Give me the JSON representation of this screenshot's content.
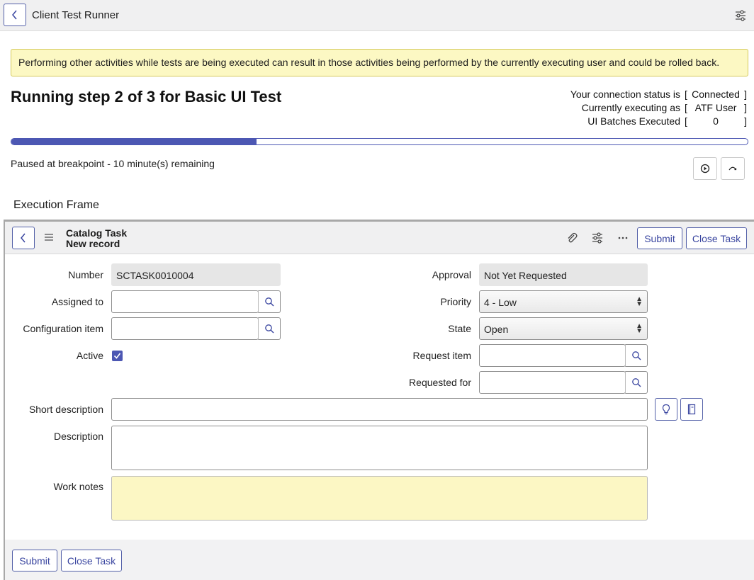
{
  "topbar": {
    "title": "Client Test Runner"
  },
  "warning": {
    "text": "Performing other activities while tests are being executed can result in those activities being performed by the currently executing user and could be rolled back."
  },
  "run": {
    "title": "Running step 2 of 3 for Basic UI Test",
    "progress_fraction": 0.333,
    "paused_text": "Paused at breakpoint - 10 minute(s) remaining"
  },
  "status": [
    {
      "label": "Your connection status is",
      "value": "Connected"
    },
    {
      "label": "Currently executing as",
      "value": "ATF User"
    },
    {
      "label": "UI Batches Executed",
      "value": "0"
    }
  ],
  "execution_frame": {
    "label": "Execution Frame"
  },
  "form": {
    "header": {
      "title": "Catalog Task",
      "subtitle": "New record",
      "submit_label": "Submit",
      "close_label": "Close Task"
    },
    "fields": {
      "number_label": "Number",
      "number_value": "SCTASK0010004",
      "assigned_to_label": "Assigned to",
      "assigned_to_value": "",
      "config_item_label": "Configuration item",
      "config_item_value": "",
      "active_label": "Active",
      "approval_label": "Approval",
      "approval_value": "Not Yet Requested",
      "priority_label": "Priority",
      "priority_value": "4 - Low",
      "state_label": "State",
      "state_value": "Open",
      "request_item_label": "Request item",
      "request_item_value": "",
      "requested_for_label": "Requested for",
      "requested_for_value": "",
      "short_description_label": "Short description",
      "description_label": "Description",
      "work_notes_label": "Work notes"
    },
    "footer": {
      "submit_label": "Submit",
      "close_label": "Close Task"
    }
  }
}
